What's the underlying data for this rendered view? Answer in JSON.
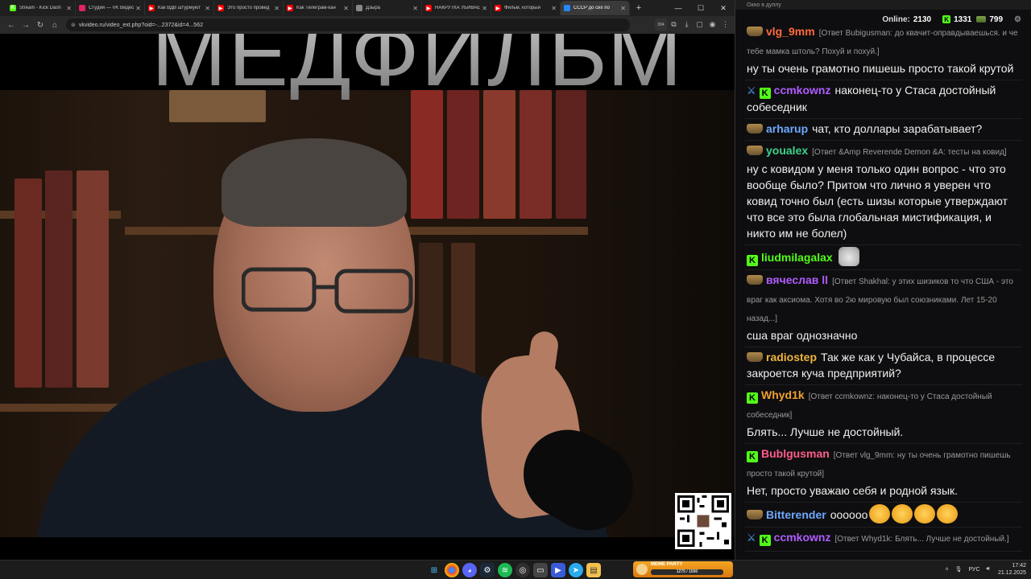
{
  "browser": {
    "tabs": [
      {
        "title": "Stream - Kick Dash",
        "color": "#53fc18",
        "glyph": "K",
        "active": false
      },
      {
        "title": "Студия — VK Видео",
        "color": "#e0245e",
        "glyph": "",
        "active": false
      },
      {
        "title": "Как ВДВ штурмуют",
        "color": "#ff0000",
        "glyph": "▶",
        "active": false
      },
      {
        "title": "Это просто провед",
        "color": "#ff0000",
        "glyph": "▶",
        "active": false
      },
      {
        "title": "Как Телеграм-кан",
        "color": "#ff0000",
        "glyph": "▶",
        "active": false
      },
      {
        "title": "Дзыра",
        "color": "#888888",
        "glyph": "",
        "active": false
      },
      {
        "title": "НАКРУТКА УБИВАЕ",
        "color": "#ff0000",
        "glyph": "▶",
        "active": false
      },
      {
        "title": "Фильм, который",
        "color": "#ff0000",
        "glyph": "▶",
        "active": false
      },
      {
        "title": "СССР до сих по",
        "color": "#2787f5",
        "glyph": "",
        "active": true
      }
    ],
    "url": "vkvideo.ru/video_ext.php?oid=-...2372&id=4...562",
    "badge_count": "304"
  },
  "video": {
    "overlay_title": "МЕДФИЛЬМ"
  },
  "chat": {
    "window_title": "Окно в дуплу",
    "online_label": "Online:",
    "online_count": "2130",
    "kick_count": "1331",
    "cash_count": "799",
    "messages": [
      {
        "badges": [
          "hat"
        ],
        "user": "vlg_9mm",
        "user_color": "#ff6a3d",
        "reply": "[Ответ Bubigusman: до квачит-оправдываешься. и че тебе мамка штоль? Похуй и похуй.]",
        "text": "ну ты очень грамотно пишешь просто такой крутой",
        "emotes": []
      },
      {
        "badges": [
          "sword",
          "k"
        ],
        "user": "ccmkownz",
        "user_color": "#b05cff",
        "reply": "",
        "text": "наконец-то у Стаса достойный собеседник",
        "emotes": []
      },
      {
        "badges": [
          "hat"
        ],
        "user": "arharup",
        "user_color": "#6fa8ff",
        "reply": "",
        "text": "чат, кто доллары зарабатывает?",
        "emotes": []
      },
      {
        "badges": [
          "hat"
        ],
        "user": "youalex",
        "user_color": "#3fd18e",
        "reply": "[Ответ &Amp Reverende Demon &A: тесты на ковид]",
        "text": "ну с ковидом у меня только один вопрос - что это вообще было? Притом что лично я уверен что ковид точно был (есть шизы которые утверждают что все это была глобальная мистификация, и никто им не болел)",
        "emotes": []
      },
      {
        "badges": [
          "k"
        ],
        "user": "liudmilagalax",
        "user_color": "#53fc18",
        "reply": "",
        "text": "",
        "emotes": [
          "cat"
        ]
      },
      {
        "badges": [
          "hat"
        ],
        "user": "вячеслав ll",
        "user_color": "#b05cff",
        "reply": "[Ответ Shakhal: у этих шизиков то что США - это враг как аксиома. Хотя во 2ю мировую был союзниками. Лет 15-20 назад...]",
        "text": "сша враг однозначно",
        "emotes": []
      },
      {
        "badges": [
          "hat"
        ],
        "user": "radiostep",
        "user_color": "#f0b43c",
        "reply": "",
        "text": "Так же как у Чубайса, в процессе закроется куча предприятий?",
        "emotes": []
      },
      {
        "badges": [
          "k"
        ],
        "user": "Whyd1k",
        "user_color": "#f0a030",
        "reply": "[Ответ ccmkownz: наконец-то у Стаса достойный собеседник]",
        "text": "Блять... Лучше не достойный.",
        "emotes": []
      },
      {
        "badges": [
          "k"
        ],
        "user": "Bublgusman",
        "user_color": "#ff5c8a",
        "reply": "[Ответ vlg_9mm: ну ты очень грамотно пишешь просто такой крутой]",
        "text": "Нет, просто уважаю себя и родной язык.",
        "emotes": []
      },
      {
        "badges": [
          "hat"
        ],
        "user": "Bitterender",
        "user_color": "#6fa8ff",
        "reply": "",
        "text": "оооооо",
        "emotes": [
          "laugh",
          "laugh",
          "laugh",
          "laugh"
        ]
      },
      {
        "badges": [
          "sword",
          "k"
        ],
        "user": "ccmkownz",
        "user_color": "#b05cff",
        "reply": "[Ответ Whyd1k: Блять... Лучше не достойный.]",
        "text": "",
        "emotes": []
      }
    ]
  },
  "taskbar": {
    "widget_title": "MEME PARTY",
    "widget_progress": "1275 / 1500",
    "lang": "РУС",
    "time": "17:42",
    "date": "21.12.2025"
  }
}
